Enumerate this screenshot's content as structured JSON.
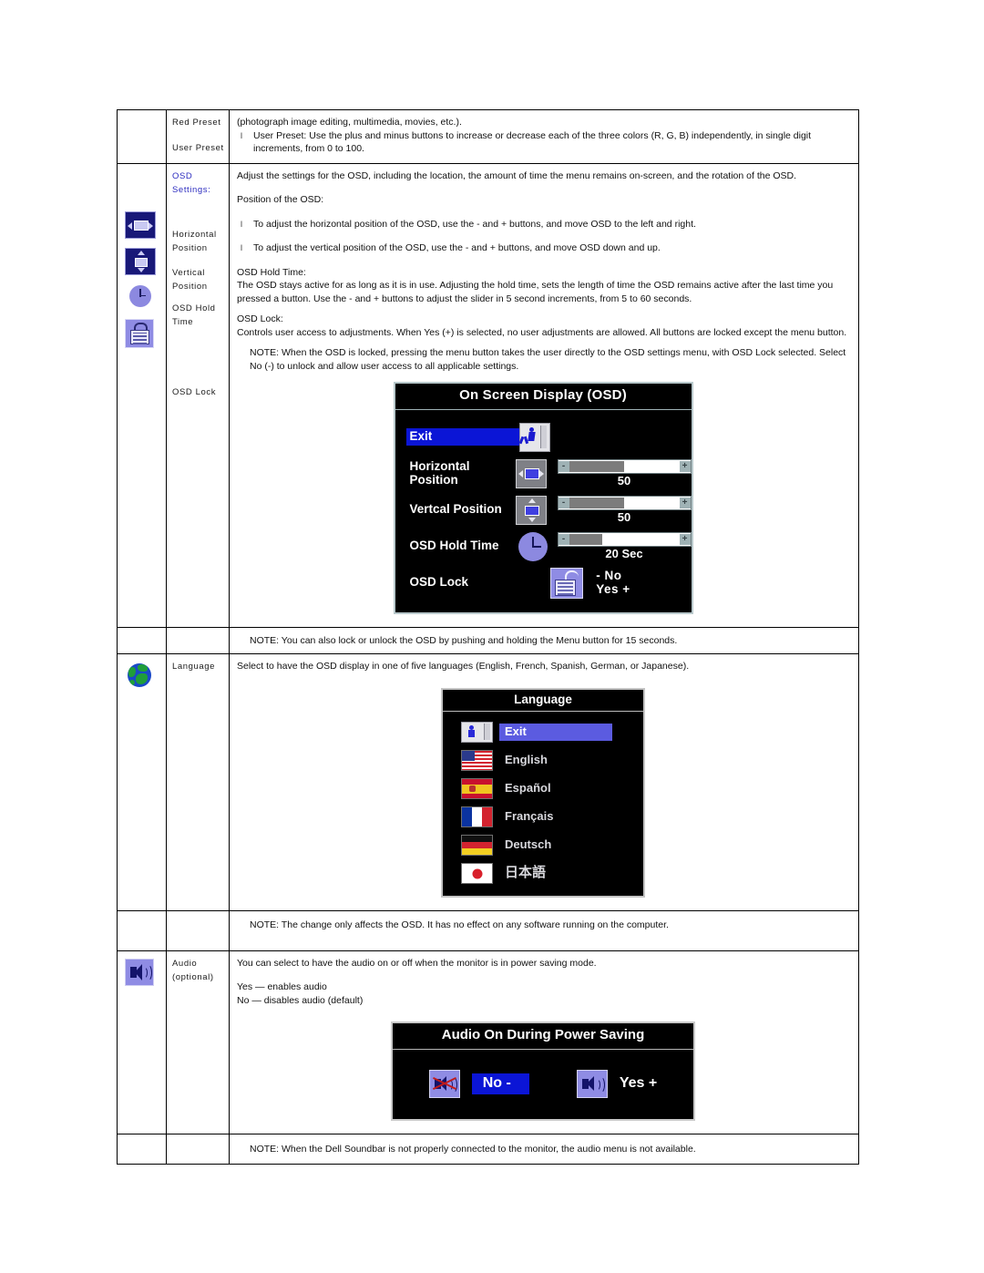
{
  "doc": {
    "rows": {
      "preset": {
        "name_line1": "Red Preset",
        "name_line2": "User Preset",
        "body_intro": "(photograph image editing, multimedia, movies, etc.).",
        "bullets": [
          "User Preset: Use the plus and minus buttons to increase or decrease each of the three colors (R, G, B) independently, in single digit increments, from 0 to 100."
        ]
      },
      "osd_settings": {
        "name_title": "OSD",
        "name_title2": "Settings:",
        "name_horizontal": "Horizontal",
        "name_horizontal2": "Position",
        "name_vertical": "Vertical",
        "name_vertical2": "Position",
        "name_hold": "OSD Hold",
        "name_hold2": "Time",
        "name_lock": "OSD Lock",
        "intro": "Adjust the settings for the OSD, including the location, the amount of time the menu remains on-screen, and the rotation of the OSD.",
        "position_heading": "Position of the OSD:",
        "bullets": [
          "To adjust the horizontal position of the OSD, use the - and + buttons, and move OSD to the left and right.",
          "To adjust the vertical position of the OSD, use the - and + buttons, and move OSD down and up."
        ],
        "hold_heading": "OSD Hold Time:",
        "hold_body": "The OSD stays active for as long as it is in use. Adjusting the hold time, sets the length of time the OSD remains active after the last time you pressed a button. Use the - and + buttons to adjust the slider in 5 second increments, from 5 to 60 seconds.",
        "lock_heading": "OSD Lock:",
        "lock_body": "Controls user access to adjustments. When Yes (+) is selected, no user adjustments are allowed. All buttons are locked except the menu button.",
        "lock_note": "NOTE: When the OSD is locked, pressing the menu button takes the user directly to the OSD settings menu, with OSD Lock selected. Select No (-) to unlock and allow user access to all applicable settings."
      },
      "osd_note": {
        "text": "NOTE: You can also lock or unlock the OSD by pushing and holding the Menu button for 15 seconds."
      },
      "language": {
        "name": "Language",
        "body": "Select to have the OSD display in one of five languages (English, French, Spanish, German, or Japanese)."
      },
      "language_note": {
        "text": "NOTE: The change only affects the OSD. It has no effect on any software running on the computer."
      },
      "audio": {
        "name_line1": "Audio",
        "name_line2": "(optional)",
        "body": "You can select to have the audio on or off when the monitor is in power saving mode.",
        "yes_line": "Yes — enables audio",
        "no_line": "No — disables audio (default)"
      },
      "audio_note": {
        "text": "NOTE: When the Dell Soundbar is not properly connected to the monitor, the audio menu is not available."
      }
    }
  },
  "osd_menu": {
    "title": "On Screen Display (OSD)",
    "exit_label": "Exit",
    "horizontal": {
      "label": "Horizontal Position",
      "value": "50",
      "fill_percent": 50
    },
    "vertical": {
      "label": "Vertcal Position",
      "value": "50",
      "fill_percent": 50
    },
    "hold_time": {
      "label": "OSD Hold Time",
      "value": "20 Sec",
      "fill_percent": 30
    },
    "lock": {
      "label": "OSD Lock",
      "no_label": "- No",
      "yes_label": "Yes +"
    },
    "slider_minus": "-",
    "slider_plus": "+"
  },
  "language_menu": {
    "title": "Language",
    "items": [
      {
        "label": "Exit",
        "flag": "exit-icon",
        "selected": true
      },
      {
        "label": "English",
        "flag": "us-flag",
        "selected": false
      },
      {
        "label": "Español",
        "flag": "spain-flag",
        "selected": false
      },
      {
        "label": "Français",
        "flag": "france-flag",
        "selected": false
      },
      {
        "label": "Deutsch",
        "flag": "germany-flag",
        "selected": false
      },
      {
        "label": "日本語",
        "flag": "japan-flag",
        "selected": false
      }
    ]
  },
  "audio_menu": {
    "title": "Audio On During Power Saving",
    "no_label": "No -",
    "yes_label": "Yes +"
  },
  "colors": {
    "link_blue": "#2b2bbf",
    "osd_highlight": "#0b15d6",
    "lang_highlight": "#5b5be0",
    "icon_navy": "#181878",
    "icon_lavender": "#8f8ce4"
  }
}
